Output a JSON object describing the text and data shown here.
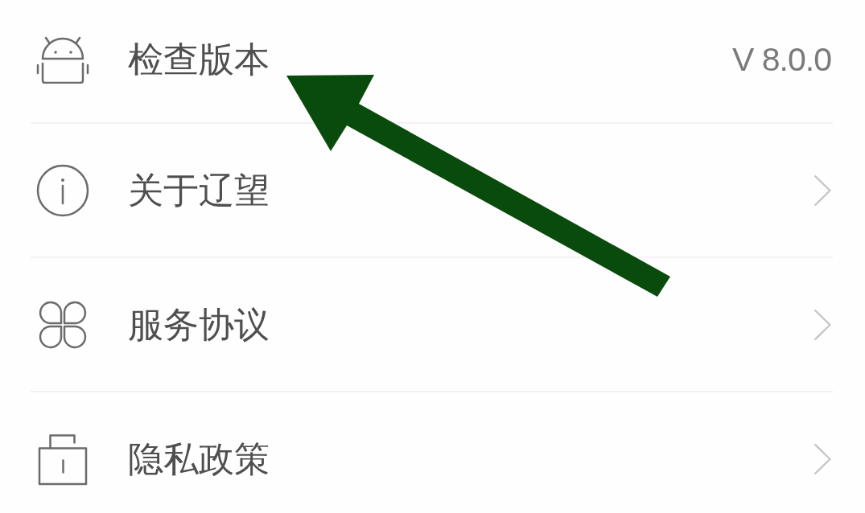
{
  "settings_list": {
    "items": [
      {
        "label": "检查版本",
        "kind": "value",
        "value": "V 8.0.0"
      },
      {
        "label": "关于辽望",
        "kind": "link"
      },
      {
        "label": "服务协议",
        "kind": "link"
      },
      {
        "label": "隐私政策",
        "kind": "link"
      }
    ]
  }
}
